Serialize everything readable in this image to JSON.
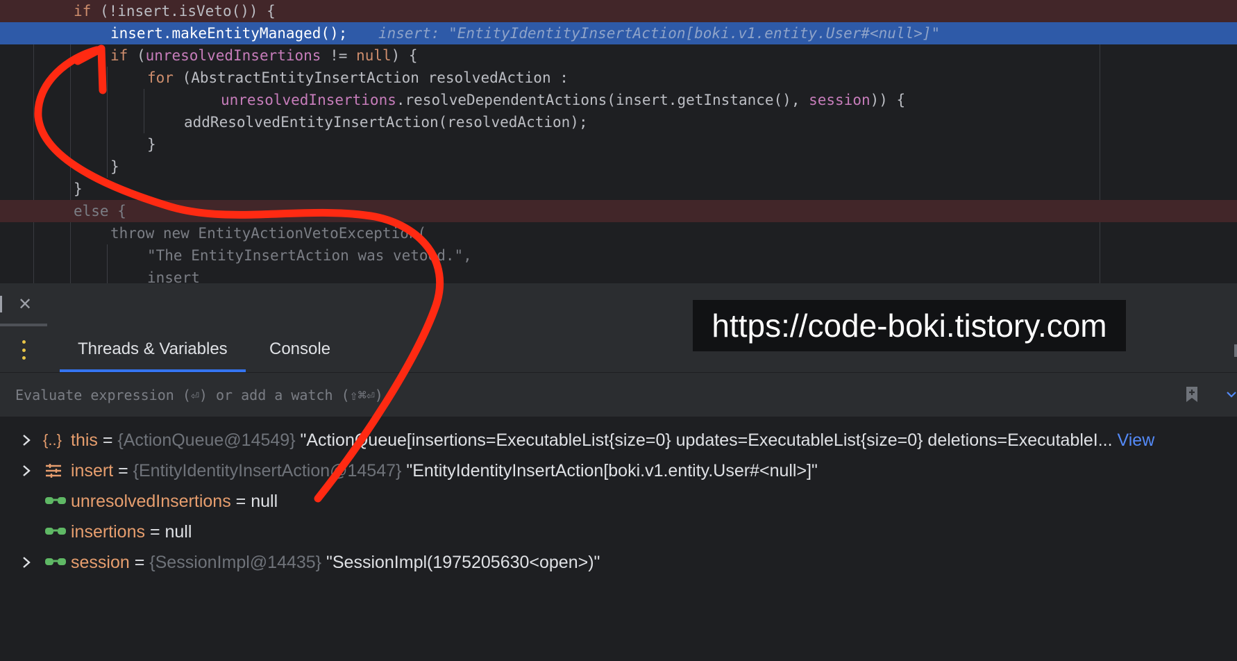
{
  "editor": {
    "lines": {
      "l1": {
        "kw": "if",
        "rest": " (!insert.isVeto()) {"
      },
      "l2": {
        "code": "insert.makeEntityManaged();",
        "hint": "insert: \"EntityIdentityInsertAction[boki.v1.entity.User#<null>]\""
      },
      "l3": {
        "kw": "if",
        "open": " (",
        "field": "unresolvedInsertions",
        "mid": " != ",
        "kw2": "null",
        "close": ") {"
      },
      "l4": {
        "kw": "for",
        "rest": " (AbstractEntityInsertAction resolvedAction :"
      },
      "l5": {
        "field": "unresolvedInsertions",
        "mid": ".resolveDependentActions(insert.getInstance(), ",
        "field2": "session",
        "close": ")) {"
      },
      "l6": {
        "code": "addResolvedEntityInsertAction(resolvedAction);"
      },
      "l7": {
        "code": "}"
      },
      "l8": {
        "code": "}"
      },
      "l9": {
        "code": "}"
      },
      "l10": {
        "code": "else {"
      },
      "l11": {
        "code": "throw new EntityActionVetoException("
      },
      "l12": {
        "code": "\"The EntityInsertAction was vetoed.\","
      },
      "l13": {
        "code": "insert"
      }
    }
  },
  "debugger": {
    "tabs": {
      "threads_variables": "Threads & Variables",
      "console": "Console"
    },
    "evaluate_placeholder": "Evaluate expression (⏎) or add a watch (⇧⌘⏎)",
    "variables": {
      "this_var": {
        "name": "this",
        "eq": " = ",
        "type": "{ActionQueue@14549}",
        "value": " \"ActionQueue[insertions=ExecutableList{size=0} updates=ExecutableList{size=0} deletions=ExecutableI...",
        "link": " View"
      },
      "insert_var": {
        "name": "insert",
        "eq": " = ",
        "type": "{EntityIdentityInsertAction@14547}",
        "value": " \"EntityIdentityInsertAction[boki.v1.entity.User#<null>]\""
      },
      "unresolved_var": {
        "name": "unresolvedInsertions",
        "eq": " = ",
        "value": "null"
      },
      "insertions_var": {
        "name": "insertions",
        "eq": " = ",
        "value": "null"
      },
      "session_var": {
        "name": "session",
        "eq": " = ",
        "type": "{SessionImpl@14435}",
        "value": " \"SessionImpl(1975205630<open>)\""
      }
    },
    "icons": {
      "object": "object-icon",
      "fields": "fields-icon",
      "watch": "glasses-icon"
    }
  },
  "watermark": "https://code-boki.tistory.com",
  "colors": {
    "error_line": "#422629",
    "exec_line": "#2e5aa8",
    "annotation": "#ff2a12",
    "accent": "#3574f0"
  }
}
